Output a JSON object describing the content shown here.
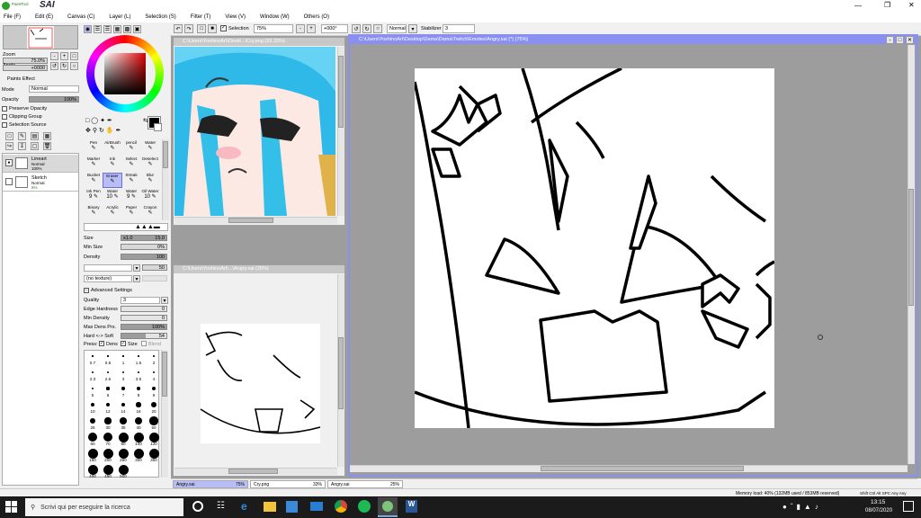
{
  "app": {
    "name": "SAI",
    "brand": "PaintTool"
  },
  "menu": [
    "File (F)",
    "Edit (E)",
    "Canvas (C)",
    "Layer (L)",
    "Selection (S)",
    "Filter (T)",
    "View (V)",
    "Window (W)",
    "Others (O)"
  ],
  "toolbar": {
    "selection_label": "Selection",
    "zoom": "75%",
    "angle": "+000°",
    "mode": "Normal",
    "stabilizer_label": "Stabilizer",
    "stabilizer": "3"
  },
  "navigator": {
    "zoom_label": "Zoom",
    "zoom_value": "75.0%",
    "angle_label": "Angle",
    "angle_value": "+0000"
  },
  "layer_panel": {
    "paints_effect": "Paints Effect",
    "mode_label": "Mode",
    "mode_value": "Normal",
    "opacity_label": "Opacity",
    "opacity_value": "100%",
    "preserve_opacity": "Preserve Opacity",
    "clipping_group": "Clipping Group",
    "selection_source": "Selection Source",
    "layers": [
      {
        "name": "Lineart",
        "mode": "Normal",
        "opacity": "100%"
      },
      {
        "name": "Sketch",
        "mode": "Normal",
        "opacity": "6%"
      }
    ]
  },
  "tools": [
    "Pen",
    "AirBrush",
    "pencil",
    "Water",
    "Marker",
    "Ink",
    "Select",
    "Deselect",
    "Bucket",
    "Eraser",
    "Streak",
    "Blur",
    "Ink Pen",
    "Water",
    "Water",
    "Oil Water",
    "Binary",
    "Acrylic",
    "Paper",
    "Crayon"
  ],
  "tool_numbers": [
    "",
    "",
    "",
    "",
    "",
    "",
    "",
    "",
    "",
    "",
    "",
    "",
    "9",
    "10",
    "9",
    "10",
    "",
    "",
    "",
    ""
  ],
  "brush": {
    "size_label": "Size",
    "size_mult": "x1.0",
    "size_value": "15.0",
    "min_size_label": "Min Size",
    "min_size_value": "0%",
    "density_label": "Density",
    "density_value": "100",
    "blend_value": "50",
    "texture_value": "(no texture)",
    "advanced": "Advanced Settings",
    "quality_label": "Quality",
    "quality_value": "3",
    "edge_hardness_label": "Edge Hardness",
    "edge_hardness_value": "0",
    "min_density_label": "Min Density",
    "min_density_value": "0",
    "max_dens_label": "Max Dens Prs.",
    "max_dens_value": "100%",
    "hard_soft_label": "Hard <-> Soft",
    "hard_soft_value": "54",
    "press_label": "Press:",
    "press_dens": "Dens",
    "press_size": "Size",
    "press_blend": "Blend",
    "sizes": [
      "0.7",
      "0.8",
      "1",
      "1.5",
      "2",
      "2.3",
      "2.6",
      "3",
      "3.5",
      "4",
      "5",
      "6",
      "7",
      "8",
      "9",
      "10",
      "12",
      "14",
      "16",
      "20",
      "25",
      "30",
      "35",
      "40",
      "50",
      "60",
      "70",
      "80",
      "100",
      "120",
      "160",
      "200",
      "250",
      "300",
      "350",
      "400",
      "450",
      "500"
    ]
  },
  "windows": {
    "cry": {
      "title": "C:\\Users\\YoshinoArt\\Deskt...\\Cry.png (33.33%)"
    },
    "angry_small": {
      "title": "C:\\Users\\YoshinoArt\\...\\Angry.sai (25%)"
    },
    "angry_main": {
      "title": "C:\\Users\\YoshinoArt\\Desktop\\Dama\\Dama\\Twitch\\Emotes\\Angry.sai (*) (75%)"
    }
  },
  "doc_tabs": [
    {
      "name": "Angry.sai",
      "zoom": "75%"
    },
    {
      "name": "Cry.png",
      "zoom": "33%"
    },
    {
      "name": "Angry.sai",
      "zoom": "25%"
    }
  ],
  "status": {
    "memory": "Memory load: 40% (132MB used / 853MB reserved)",
    "keys": "Shift Ctrl Alt SPC Any Any"
  },
  "taskbar": {
    "search_placeholder": "Scrivi qui per eseguire la ricerca",
    "time": "13:15",
    "date": "08/07/2020"
  },
  "colors": {
    "accent": "#8a8ff2",
    "selected_tab": "#b8bdf7",
    "canvas_bg": "#9d9d9d",
    "taskbar": "#1b1b1b",
    "cry_blue": "#34bfe8"
  }
}
